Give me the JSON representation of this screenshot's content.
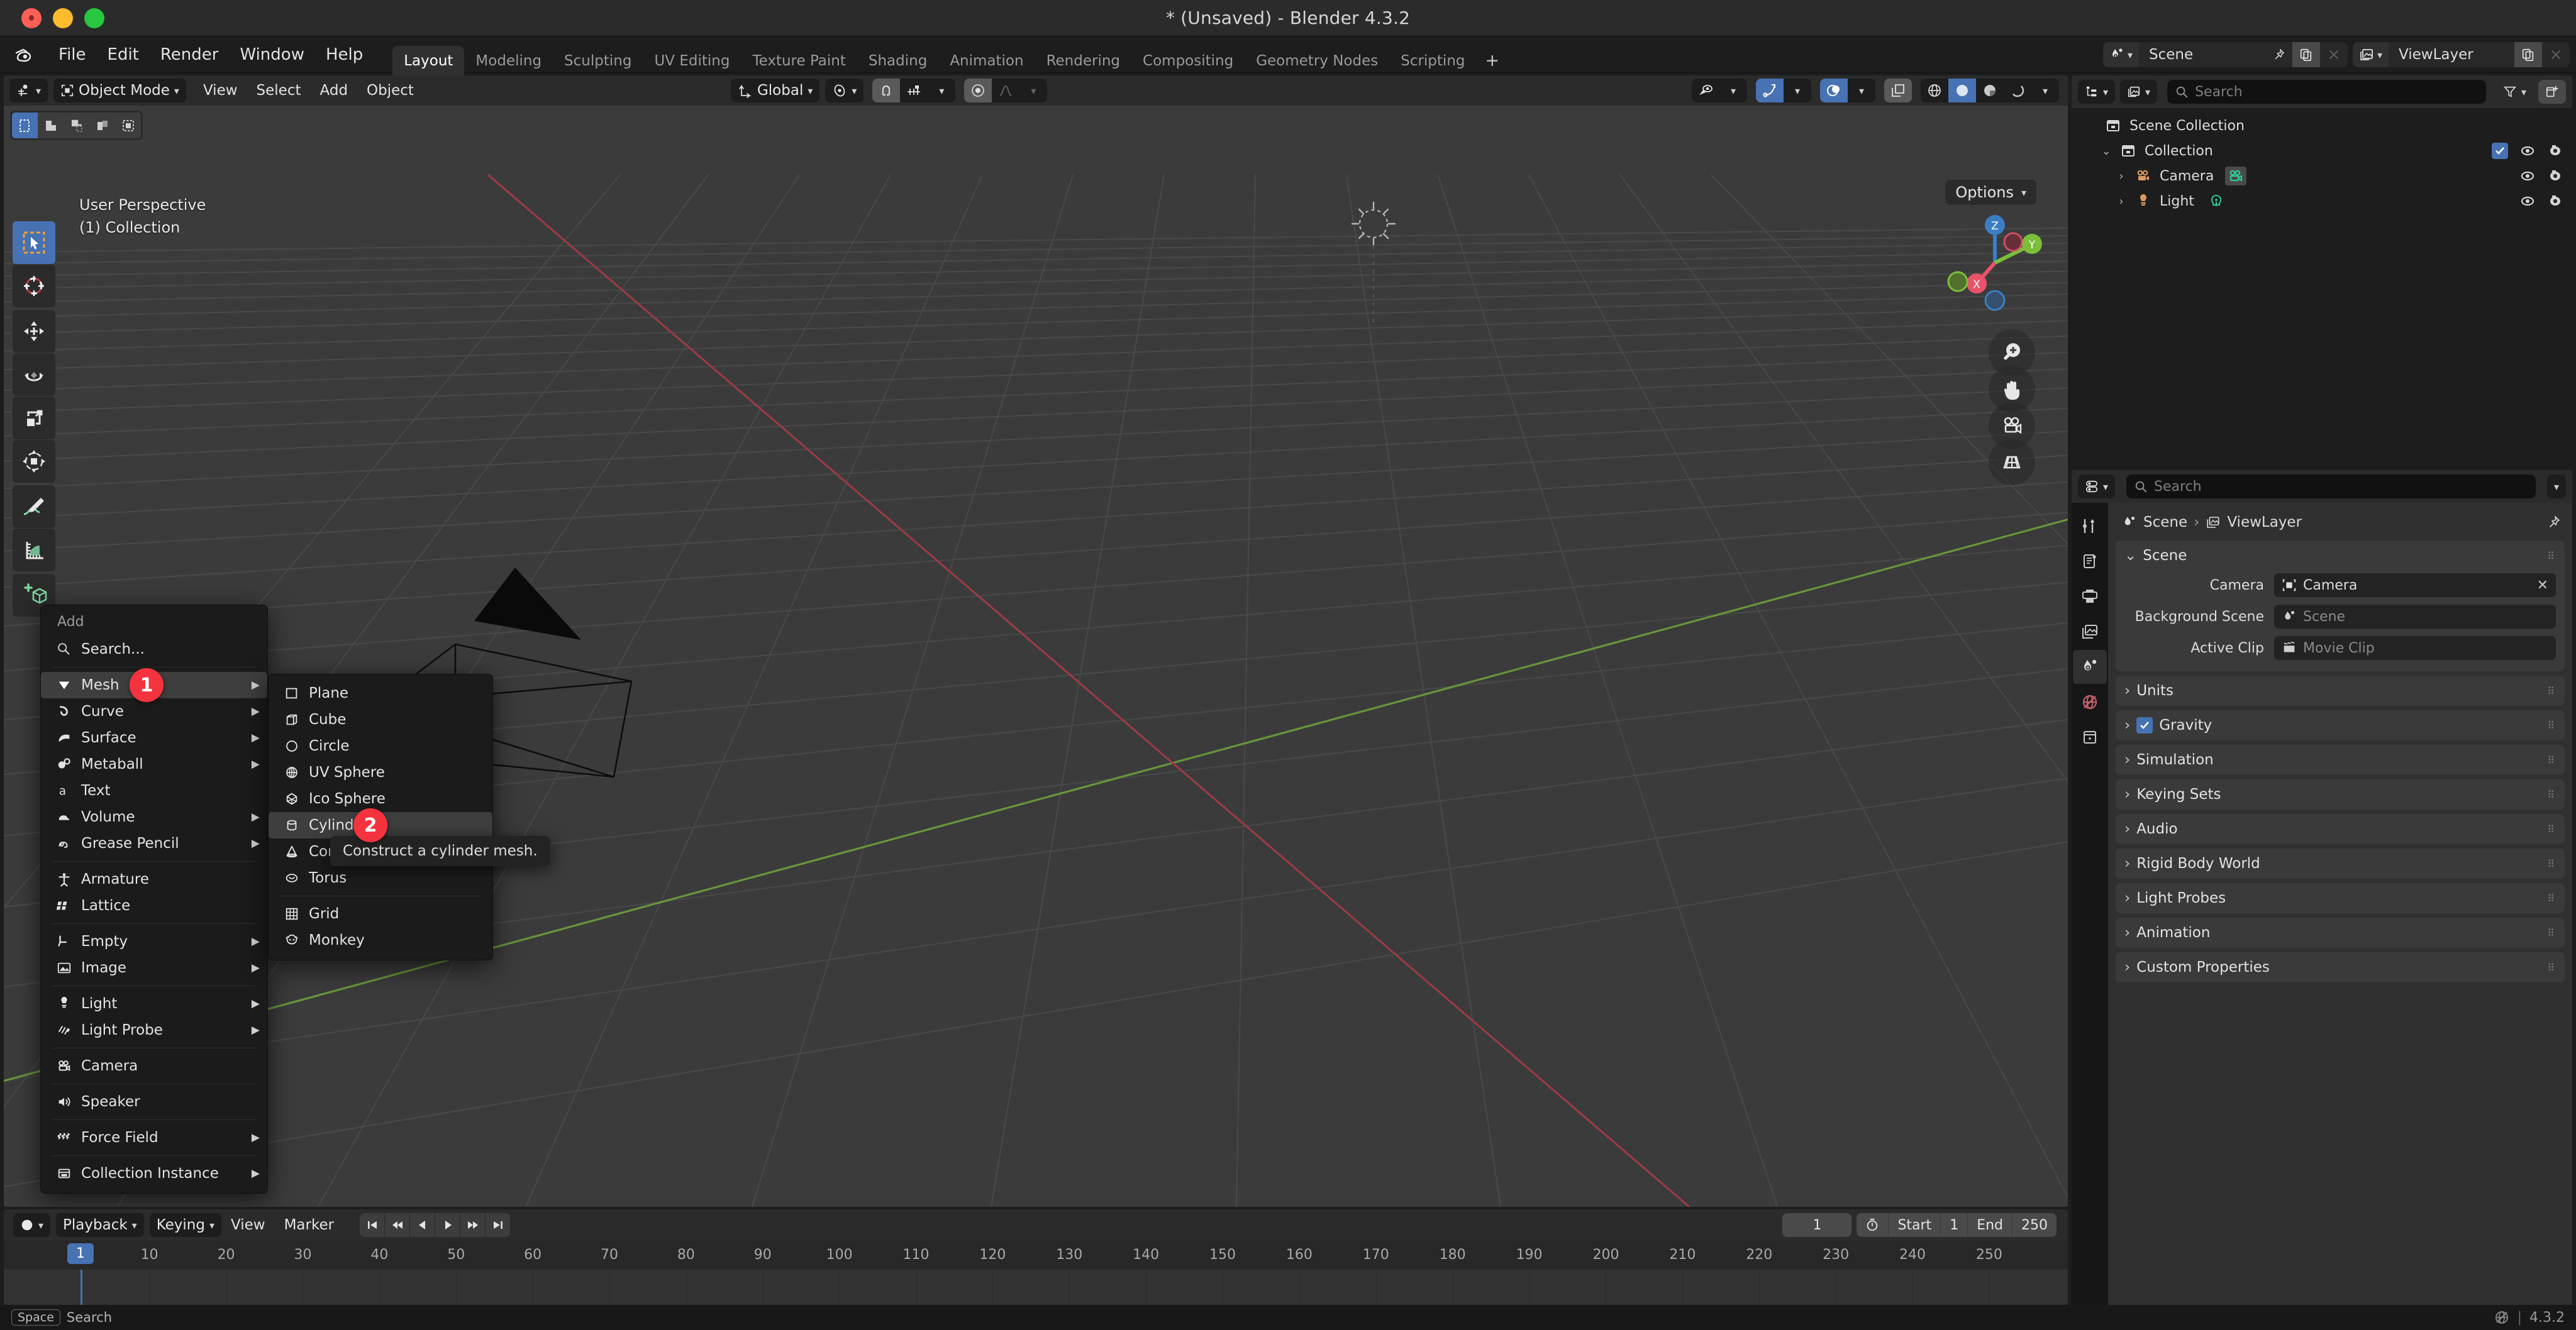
{
  "window": {
    "title": "* (Unsaved) - Blender 4.3.2",
    "traffic": {
      "close": "close-button",
      "minimize": "minimize-button",
      "zoom": "zoom-button"
    }
  },
  "topbar": {
    "menus": [
      "File",
      "Edit",
      "Render",
      "Window",
      "Help"
    ],
    "workspaces": [
      {
        "label": "Layout",
        "active": true
      },
      {
        "label": "Modeling",
        "active": false
      },
      {
        "label": "Sculpting",
        "active": false
      },
      {
        "label": "UV Editing",
        "active": false
      },
      {
        "label": "Texture Paint",
        "active": false
      },
      {
        "label": "Shading",
        "active": false
      },
      {
        "label": "Animation",
        "active": false
      },
      {
        "label": "Rendering",
        "active": false
      },
      {
        "label": "Compositing",
        "active": false
      },
      {
        "label": "Geometry Nodes",
        "active": false
      },
      {
        "label": "Scripting",
        "active": false
      }
    ],
    "add_workspace": "+",
    "scene_name": "Scene",
    "viewlayer_name": "ViewLayer"
  },
  "viewport": {
    "mode": "Object Mode",
    "menus": [
      "View",
      "Select",
      "Add",
      "Object"
    ],
    "transform_orientation": "Global",
    "options_label": "Options",
    "overlay_line1": "User Perspective",
    "overlay_line2": "(1) Collection",
    "gizmo_axes": {
      "x": "X",
      "y": "Y",
      "z": "Z"
    },
    "select_modes": [
      "select-box",
      "select-cursor",
      "select-move",
      "select-rotate",
      "select-scale"
    ],
    "tools": [
      "tweak-select-tool",
      "cursor-tool",
      "move-tool",
      "rotate-tool",
      "scale-tool",
      "transform-tool",
      "annotate-tool",
      "measure-tool",
      "add-cube-tool"
    ]
  },
  "add_menu": {
    "title": "Add",
    "groups": [
      [
        {
          "label": "Search...",
          "icon": "search-icon",
          "arrow": false
        }
      ],
      [
        {
          "label": "Mesh",
          "icon": "mesh-icon",
          "arrow": true,
          "highlighted": true,
          "badge": "1"
        },
        {
          "label": "Curve",
          "icon": "curve-icon",
          "arrow": true
        },
        {
          "label": "Surface",
          "icon": "surface-icon",
          "arrow": true
        },
        {
          "label": "Metaball",
          "icon": "metaball-icon",
          "arrow": true
        },
        {
          "label": "Text",
          "icon": "text-icon",
          "arrow": false
        },
        {
          "label": "Volume",
          "icon": "volume-icon",
          "arrow": true
        },
        {
          "label": "Grease Pencil",
          "icon": "grease-pencil-icon",
          "arrow": true
        }
      ],
      [
        {
          "label": "Armature",
          "icon": "armature-icon",
          "arrow": false
        },
        {
          "label": "Lattice",
          "icon": "lattice-icon",
          "arrow": false
        }
      ],
      [
        {
          "label": "Empty",
          "icon": "empty-icon",
          "arrow": true
        },
        {
          "label": "Image",
          "icon": "image-icon",
          "arrow": true
        }
      ],
      [
        {
          "label": "Light",
          "icon": "light-icon",
          "arrow": true
        },
        {
          "label": "Light Probe",
          "icon": "light-probe-icon",
          "arrow": true
        }
      ],
      [
        {
          "label": "Camera",
          "icon": "camera-icon",
          "arrow": false
        }
      ],
      [
        {
          "label": "Speaker",
          "icon": "speaker-icon",
          "arrow": false
        }
      ],
      [
        {
          "label": "Force Field",
          "icon": "force-field-icon",
          "arrow": true
        }
      ],
      [
        {
          "label": "Collection Instance",
          "icon": "collection-instance-icon",
          "arrow": true
        }
      ]
    ]
  },
  "mesh_submenu": {
    "groups": [
      [
        {
          "label": "Plane",
          "icon": "plane-icon"
        },
        {
          "label": "Cube",
          "icon": "cube-icon"
        },
        {
          "label": "Circle",
          "icon": "circle-icon"
        },
        {
          "label": "UV Sphere",
          "icon": "uv-sphere-icon"
        },
        {
          "label": "Ico Sphere",
          "icon": "ico-sphere-icon"
        },
        {
          "label": "Cylinder",
          "icon": "cylinder-icon",
          "highlighted": true,
          "badge": "2"
        },
        {
          "label": "Cone",
          "icon": "cone-icon"
        },
        {
          "label": "Torus",
          "icon": "torus-icon"
        }
      ],
      [
        {
          "label": "Grid",
          "icon": "grid-icon"
        },
        {
          "label": "Monkey",
          "icon": "monkey-icon"
        }
      ]
    ],
    "tooltip": "Construct a cylinder mesh."
  },
  "outliner": {
    "search_placeholder": "Search",
    "rows": [
      {
        "label": "Scene Collection",
        "icon": "scene-collection-icon",
        "indent": 0,
        "expandable": false,
        "checkbox": false,
        "eye": false,
        "camera": false
      },
      {
        "label": "Collection",
        "icon": "collection-icon",
        "indent": 1,
        "expandable": true,
        "checkbox": true,
        "eye": true,
        "camera": true
      },
      {
        "label": "Camera",
        "icon": "camera-object-icon",
        "indent": 2,
        "expandable": true,
        "checkbox": false,
        "eye": true,
        "camera": true,
        "data_icon": "camera-data-icon"
      },
      {
        "label": "Light",
        "icon": "light-object-icon",
        "indent": 2,
        "expandable": true,
        "checkbox": false,
        "eye": true,
        "camera": true,
        "data_icon": "light-data-icon"
      }
    ]
  },
  "properties": {
    "search_placeholder": "Search",
    "breadcrumb": [
      "Scene",
      "ViewLayer"
    ],
    "tabs": [
      {
        "name": "tool-tab",
        "active": false
      },
      {
        "name": "render-tab",
        "active": false
      },
      {
        "name": "output-tab",
        "active": false
      },
      {
        "name": "view-layer-tab",
        "active": false
      },
      {
        "name": "scene-tab",
        "active": true
      },
      {
        "name": "world-tab",
        "active": false
      },
      {
        "name": "collection-tab",
        "active": false
      }
    ],
    "scene_panel": {
      "title": "Scene",
      "expanded": true,
      "fields": [
        {
          "label": "Camera",
          "value": "Camera",
          "placeholder": "",
          "icon": "camera-field-icon",
          "clearable": true
        },
        {
          "label": "Background Scene",
          "value": "",
          "placeholder": "Scene",
          "icon": "scene-field-icon",
          "clearable": false
        },
        {
          "label": "Active Clip",
          "value": "",
          "placeholder": "Movie Clip",
          "icon": "clip-field-icon",
          "clearable": false
        }
      ]
    },
    "panels": [
      {
        "label": "Units",
        "checkbox": false
      },
      {
        "label": "Gravity",
        "checkbox": true,
        "checked": true
      },
      {
        "label": "Simulation",
        "checkbox": false
      },
      {
        "label": "Keying Sets",
        "checkbox": false
      },
      {
        "label": "Audio",
        "checkbox": false
      },
      {
        "label": "Rigid Body World",
        "checkbox": false
      },
      {
        "label": "Light Probes",
        "checkbox": false
      },
      {
        "label": "Animation",
        "checkbox": false
      },
      {
        "label": "Custom Properties",
        "checkbox": false
      }
    ]
  },
  "timeline": {
    "editor_menus": [
      "Playback",
      "Keying",
      "View",
      "Marker"
    ],
    "playback_label": "Playback",
    "keying_label": "Keying",
    "current_frame": "1",
    "start_label": "Start",
    "start_value": "1",
    "end_label": "End",
    "end_value": "250",
    "ticks": [
      "10",
      "20",
      "30",
      "40",
      "50",
      "60",
      "70",
      "80",
      "90",
      "100",
      "110",
      "120",
      "130",
      "140",
      "150",
      "160",
      "170",
      "180",
      "190",
      "200",
      "210",
      "220",
      "230",
      "240",
      "250"
    ]
  },
  "statusbar": {
    "key": "Space",
    "action": "Search",
    "version": "4.3.2"
  },
  "colors": {
    "accent_blue": "#4772b3",
    "badge_red": "#f5333f",
    "axis_x": "#e8536a",
    "axis_y": "#7bbf3a",
    "axis_z": "#3b7ec4",
    "bg_dark": "#1d1d1d",
    "bg_viewport": "#3b3b3b"
  }
}
